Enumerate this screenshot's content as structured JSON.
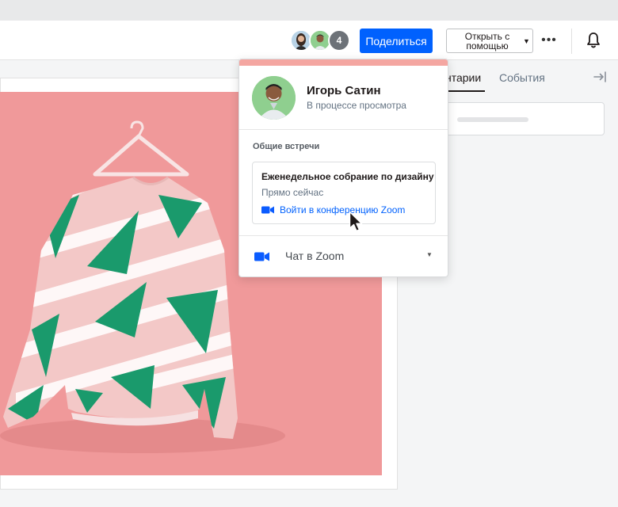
{
  "header": {
    "avatar_count": "4",
    "share_label": "Поделиться",
    "open_with_label": "Открыть с помощью",
    "more_label": "•••"
  },
  "sidebar": {
    "tabs": [
      {
        "label": "нтарии"
      },
      {
        "label": "События"
      }
    ]
  },
  "popover": {
    "user_name": "Игорь Сатин",
    "user_status": "В процессе просмотра",
    "section_title": "Общие встречи",
    "meeting": {
      "title": "Еженедельное собрание по дизайну",
      "time": "Прямо сейчас",
      "join_label": "Войти в конференцию Zoom"
    },
    "chat_label": "Чат в Zoom"
  },
  "colors": {
    "accent": "#0061fe",
    "popover_top": "#f4a6a1",
    "photo_bg": "#f0999a",
    "shirt_green": "#1a9a6c"
  },
  "icons": [
    "bell-icon",
    "collapse-panel-icon",
    "zoom-video-icon",
    "chevron-down-icon",
    "mouse-cursor-icon"
  ]
}
